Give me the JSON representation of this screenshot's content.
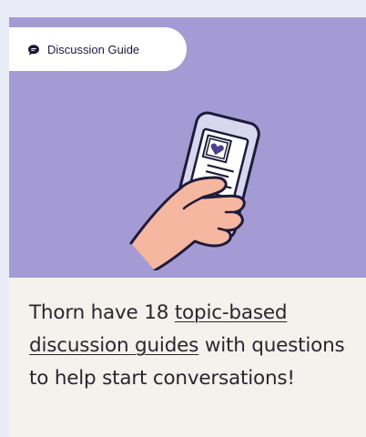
{
  "card": {
    "badge": {
      "icon": "speech-bubble-icon",
      "label": "Discussion Guide"
    },
    "illustration": "hand-holding-phone-with-heart-illustration",
    "body": {
      "text_before": "Thorn have 18 ",
      "link_label": "topic-based discussion guides",
      "text_after": " with questions to help start conversations!"
    }
  },
  "colors": {
    "page_background": "#e9ecf6",
    "hero_background": "#a59bd4",
    "card_background": "#f5f1ec",
    "phone_fill": "#d9d6f0",
    "hand_fill": "#f5b7a0",
    "outline": "#1e1a3a"
  }
}
